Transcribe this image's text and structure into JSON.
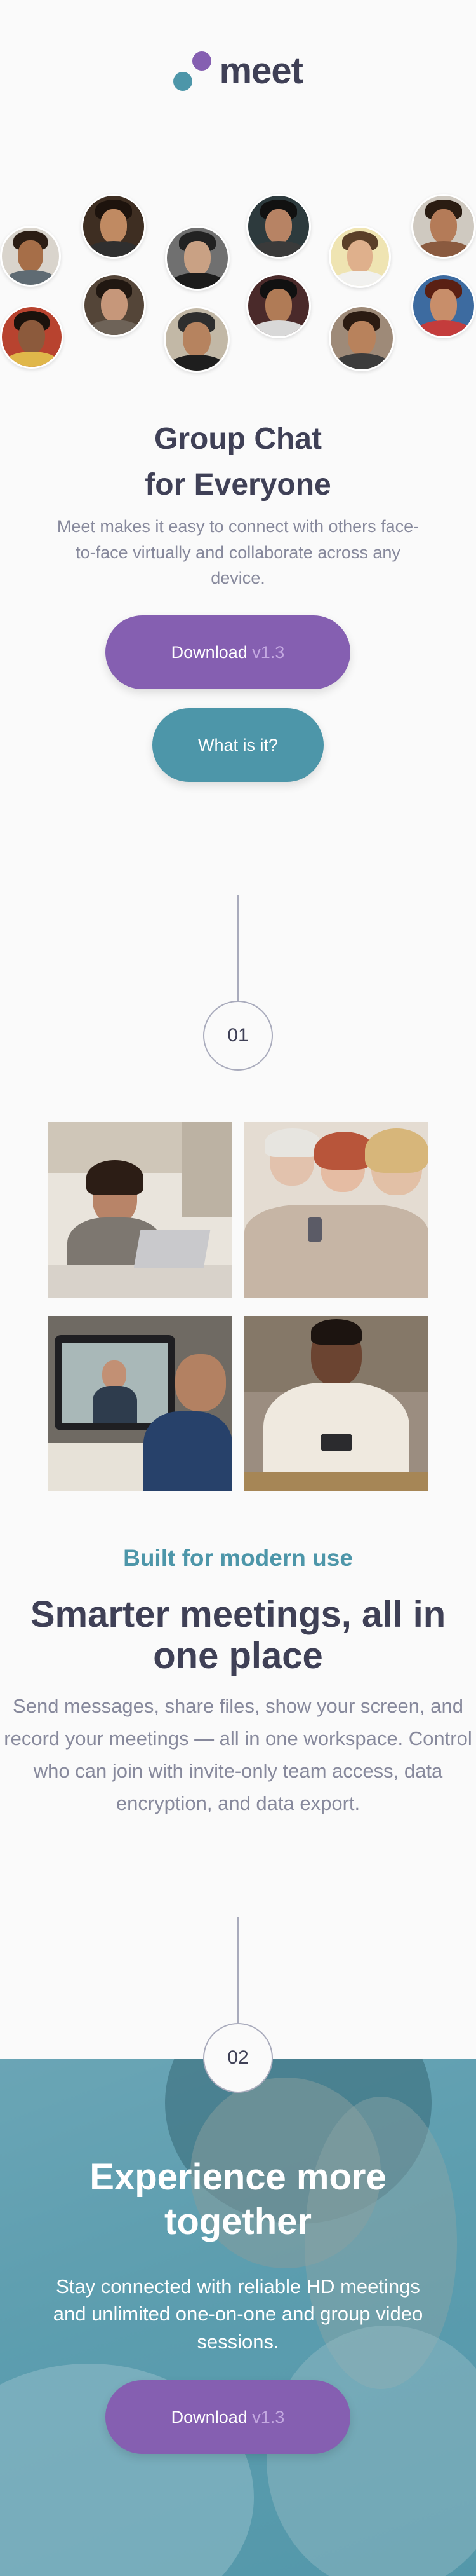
{
  "brand": {
    "name": "meet",
    "colors": {
      "primary": "#855fb1",
      "secondary": "#4d96a9",
      "text": "#3f4056",
      "muted": "#87899c"
    }
  },
  "hero": {
    "title_line1": "Group Chat",
    "title_line2": "for Everyone",
    "description": "Meet makes it easy to connect with others face-to-face virtually and collaborate across any device.",
    "download_label": "Download",
    "download_version": "v1.3",
    "what_label": "What is it?"
  },
  "steps": {
    "first": "01",
    "second": "02"
  },
  "features": {
    "tagline": "Built for modern use",
    "title": "Smarter meetings, all in one place",
    "description": "Send messages, share files, show your screen, and record your meetings — all in one workspace. Control who can join with invite-only team access, data encryption, and data export."
  },
  "cta": {
    "title_line1": "Experience more",
    "title_line2": "together",
    "description": "Stay connected with reliable HD meetings and unlimited one-on-one and group video sessions.",
    "download_label": "Download",
    "download_version": "v1.3"
  }
}
